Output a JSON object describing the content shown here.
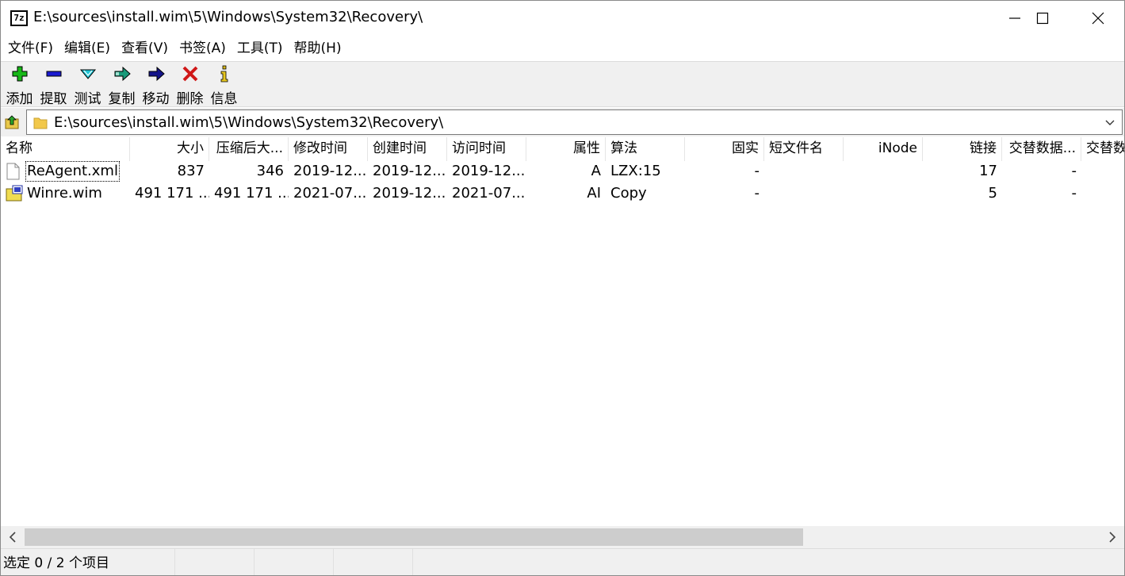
{
  "window": {
    "title": "E:\\sources\\install.wim\\5\\Windows\\System32\\Recovery\\",
    "app_icon_text": "7z"
  },
  "menu": [
    "文件(F)",
    "编辑(E)",
    "查看(V)",
    "书签(A)",
    "工具(T)",
    "帮助(H)"
  ],
  "toolbar": [
    {
      "label": "添加",
      "icon": "add-icon"
    },
    {
      "label": "提取",
      "icon": "extract-icon"
    },
    {
      "label": "测试",
      "icon": "test-icon"
    },
    {
      "label": "复制",
      "icon": "copy-icon"
    },
    {
      "label": "移动",
      "icon": "move-icon"
    },
    {
      "label": "删除",
      "icon": "delete-icon"
    },
    {
      "label": "信息",
      "icon": "info-icon"
    }
  ],
  "address": {
    "path": "E:\\sources\\install.wim\\5\\Windows\\System32\\Recovery\\"
  },
  "columns": [
    "名称",
    "大小",
    "压缩后大...",
    "修改时间",
    "创建时间",
    "访问时间",
    "属性",
    "算法",
    "固实",
    "短文件名",
    "iNode",
    "链接",
    "交替数据...",
    "交替数"
  ],
  "rows": [
    {
      "icon": "xml-file-icon",
      "name": "ReAgent.xml",
      "size": "837",
      "packed": "346",
      "modified": "2019-12...",
      "created": "2019-12...",
      "accessed": "2019-12...",
      "attributes": "A",
      "method": "LZX:15",
      "solid": "-",
      "short_name": "",
      "inode": "",
      "links": "17",
      "alt_streams": "-",
      "alt_streams2": ""
    },
    {
      "icon": "wim-file-icon",
      "name": "Winre.wim",
      "size": "491 171 ...",
      "packed": "491 171 ...",
      "modified": "2021-07...",
      "created": "2019-12...",
      "accessed": "2021-07...",
      "attributes": "AI",
      "method": "Copy",
      "solid": "-",
      "short_name": "",
      "inode": "",
      "links": "5",
      "alt_streams": "-",
      "alt_streams2": ""
    }
  ],
  "status": {
    "selection": "选定 0 / 2 个项目",
    "panel2": "",
    "panel3": "",
    "panel4": ""
  }
}
